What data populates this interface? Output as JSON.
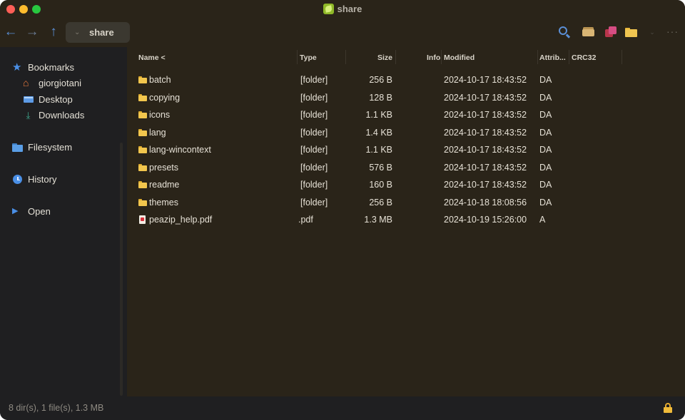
{
  "window": {
    "title": "share"
  },
  "toolbar": {
    "back_icon": "arrow-left-icon",
    "forward_icon": "arrow-right-icon",
    "up_icon": "arrow-up-icon",
    "path_label": "share",
    "accent": "#5b8fd6"
  },
  "sidebar": {
    "bookmarks_label": "Bookmarks",
    "bookmarks": [
      {
        "label": "giorgiotani",
        "icon": "home-icon"
      },
      {
        "label": "Desktop",
        "icon": "desktop-icon"
      },
      {
        "label": "Downloads",
        "icon": "download-icon"
      }
    ],
    "filesystem_label": "Filesystem",
    "history_label": "History",
    "open_label": "Open"
  },
  "filelist": {
    "columns": [
      "Name <",
      "Type",
      "Size",
      "Info",
      "Modified",
      "Attrib...",
      "CRC32"
    ],
    "rows": [
      {
        "name": "batch",
        "type": "[folder]",
        "size": "256 B",
        "modified": "2024-10-17 18:43:52",
        "attrib": "DA",
        "icon": "folder-icon"
      },
      {
        "name": "copying",
        "type": "[folder]",
        "size": "128 B",
        "modified": "2024-10-17 18:43:52",
        "attrib": "DA",
        "icon": "folder-icon"
      },
      {
        "name": "icons",
        "type": "[folder]",
        "size": "1.1 KB",
        "modified": "2024-10-17 18:43:52",
        "attrib": "DA",
        "icon": "folder-icon"
      },
      {
        "name": "lang",
        "type": "[folder]",
        "size": "1.4 KB",
        "modified": "2024-10-17 18:43:52",
        "attrib": "DA",
        "icon": "folder-icon"
      },
      {
        "name": "lang-wincontext",
        "type": "[folder]",
        "size": "1.1 KB",
        "modified": "2024-10-17 18:43:52",
        "attrib": "DA",
        "icon": "folder-icon"
      },
      {
        "name": "presets",
        "type": "[folder]",
        "size": "576 B",
        "modified": "2024-10-17 18:43:52",
        "attrib": "DA",
        "icon": "folder-icon"
      },
      {
        "name": "readme",
        "type": "[folder]",
        "size": "160 B",
        "modified": "2024-10-17 18:43:52",
        "attrib": "DA",
        "icon": "folder-icon"
      },
      {
        "name": "themes",
        "type": "[folder]",
        "size": "256 B",
        "modified": "2024-10-18 18:08:56",
        "attrib": "DA",
        "icon": "folder-icon"
      },
      {
        "name": "peazip_help.pdf",
        "type": ".pdf",
        "size": "1.3 MB",
        "modified": "2024-10-19 15:26:00",
        "attrib": "A",
        "icon": "pdf-file-icon"
      }
    ]
  },
  "statusbar": {
    "summary": "8 dir(s), 1 file(s), 1.3 MB"
  }
}
